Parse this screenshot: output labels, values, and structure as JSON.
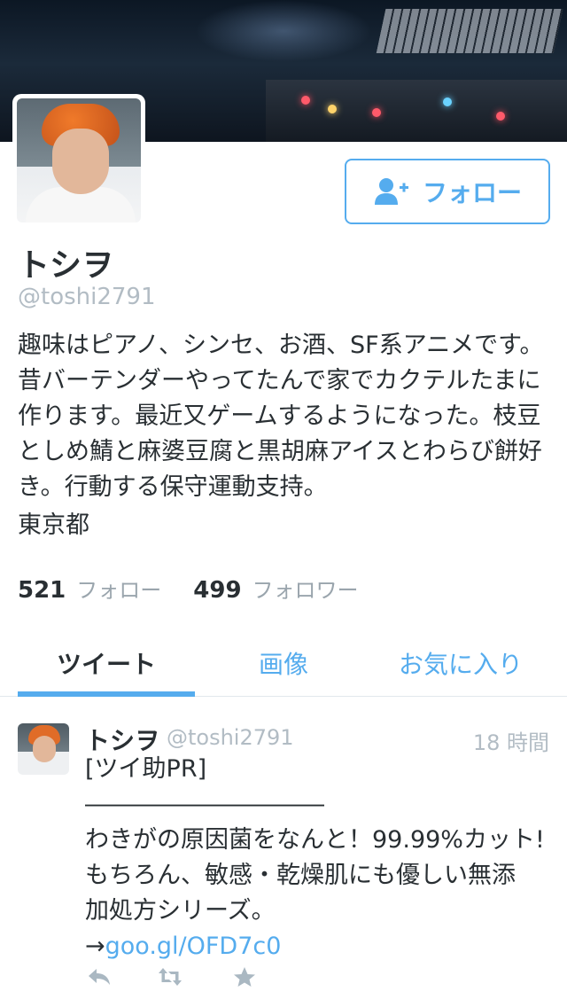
{
  "profile": {
    "follow_button_label": "フォロー",
    "name": "トシヲ",
    "handle": "@toshi2791",
    "bio": "趣味はピアノ、シンセ、お酒、SF系アニメです。昔バーテンダーやってたんで家でカクテルたまに作ります。最近又ゲームするようになった。枝豆としめ鯖と麻婆豆腐と黒胡麻アイスとわらび餅好き。行動する保守運動支持。",
    "location": "東京都",
    "stats": {
      "following_count": "521",
      "following_label": "フォロー",
      "followers_count": "499",
      "followers_label": "フォロワー"
    }
  },
  "tabs": [
    {
      "label": "ツイート",
      "active": true
    },
    {
      "label": "画像",
      "active": false
    },
    {
      "label": "お気に入り",
      "active": false
    }
  ],
  "tweet": {
    "name": "トシヲ",
    "handle": "@toshi2791",
    "time": "18 時間",
    "lines": [
      "[ツイ助PR]",
      "――――――――――",
      "わきがの原因菌をなんと！99.99%カット!",
      "もちろん、敏感・乾燥肌にも優しい無添",
      "加処方シリーズ。"
    ],
    "arrow": "→",
    "link": "goo.gl/OFD7c0",
    "actions": [
      "reply-icon",
      "retweet-icon",
      "favorite-icon"
    ]
  },
  "colors": {
    "accent": "#55acee",
    "text": "#292f33",
    "muted": "#b2bcc4",
    "divider": "#e1e8ed"
  }
}
